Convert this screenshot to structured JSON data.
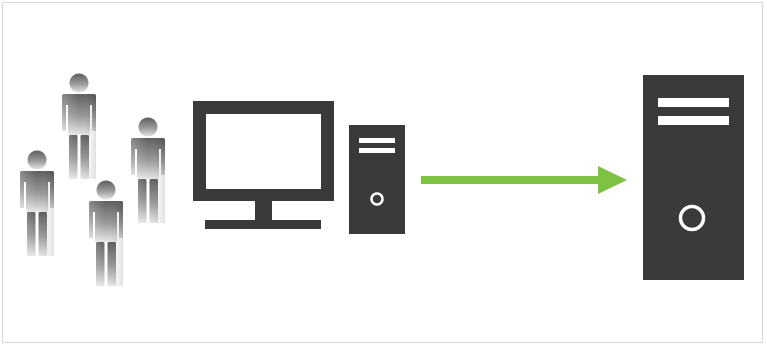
{
  "diagram": {
    "users_label": "",
    "client_label": "",
    "server_label": "",
    "arrow_label": ""
  },
  "colors": {
    "device_dark": "#3a3a3a",
    "device_screen": "#ffffff",
    "arrow_green": "#7dc242",
    "person_light": "#d6d6d6",
    "person_dark": "#6a6a6a",
    "frame_border": "#d8d8d8"
  },
  "icons": {
    "people": "person-group-icon",
    "monitor": "monitor-icon",
    "client_tower": "desktop-tower-icon",
    "arrow": "arrow-right-icon",
    "server": "server-tower-icon"
  }
}
